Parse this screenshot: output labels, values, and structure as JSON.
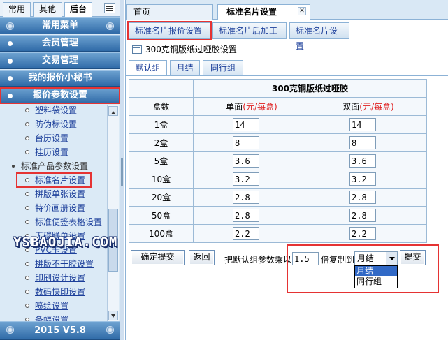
{
  "sidebar": {
    "tabs": [
      "常用",
      "其他",
      "后台"
    ],
    "active_tab": "后台",
    "sections": [
      "常用菜单",
      "会员管理",
      "交易管理",
      "我的报价小秘书",
      "报价参数设置"
    ],
    "items": [
      "塑料袋设置",
      "防伪标设置",
      "台历设置",
      "挂历设置",
      "标准产品参数设置",
      "标准名片设置",
      "拼版单张设置",
      "特价画册设置",
      "标准便签表格设置",
      "无碳联单设置",
      "PVC卡设置",
      "拼版不干胶设置",
      "印刷设计设置",
      "数码快印设置",
      "喷绘设置",
      "条幅设置"
    ],
    "selected_item": "标准名片设置",
    "watermark": "YSBAOJIA.COM",
    "footer": "2015 V5.8"
  },
  "top_tabs": [
    "首页",
    "标准名片设置"
  ],
  "sub_tabs": [
    "标准名片报价设置",
    "标准名片后加工",
    "标准名片设置"
  ],
  "page_title": "300克铜版纸过哑胶设置",
  "group_tabs": [
    "默认组",
    "月结",
    "同行组"
  ],
  "table": {
    "title": "300克铜版纸过哑胶",
    "col_qty": "盒数",
    "col_single": "单面",
    "col_double": "双面",
    "unit": "(元/每盒)",
    "rows": [
      {
        "qty": "1盒",
        "single": "14",
        "double": "14"
      },
      {
        "qty": "2盒",
        "single": "8",
        "double": "8"
      },
      {
        "qty": "5盒",
        "single": "3.6",
        "double": "3.6"
      },
      {
        "qty": "10盒",
        "single": "3.2",
        "double": "3.2"
      },
      {
        "qty": "20盒",
        "single": "2.8",
        "double": "2.8"
      },
      {
        "qty": "50盒",
        "single": "2.8",
        "double": "2.8"
      },
      {
        "qty": "100盒",
        "single": "2.2",
        "double": "2.2"
      }
    ]
  },
  "actions": {
    "confirm": "确定提交",
    "back": "返回",
    "multiply_label": "把默认组参数乘以",
    "multiplier": "1.5",
    "copy_label": "倍复制到",
    "target_group": "月结",
    "target_options": [
      "月结",
      "同行组"
    ],
    "submit": "提交"
  },
  "colors": {
    "highlight": "#e53333",
    "accent": "#2f6aa7",
    "link": "#1c3f9a"
  }
}
